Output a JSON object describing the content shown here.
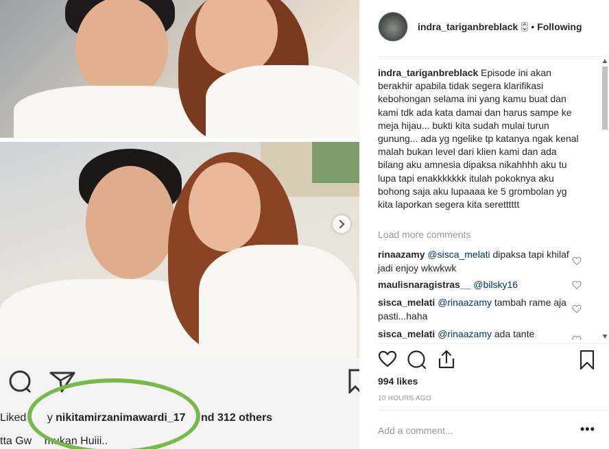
{
  "post": {
    "username": "indra_tariganbreblack",
    "following_label": "Following",
    "caption_user": "indra_tariganbreblack",
    "caption_text": "Episode ini akan berakhir apabila tidak segera klarifikasi kebohongan selama ini yang kamu buat dan kami tdk ada kata damai dan harus sampe ke meja hijau... bukti kita sudah mulai turun gunung... ada yg ngelike tp katanya ngak kenal malah bukan level dari klien kami dan ada bilang aku amnesia dipaksa nikahhhh aku tu lupa tapi enakkkkkkk itulah pokoknya aku bohong saja aku lupaaaa ke 5 grombolan yg kita laporkan segera kita seretttttt",
    "load_more": "Load more comments",
    "comments": [
      {
        "user": "rinaazamy",
        "mention": "@sisca_melati",
        "text": "dipaksa tapi khilaf jadi enjoy wkwkwk"
      },
      {
        "user": "maulisnaragistras__",
        "mention": "@bilsky16",
        "text": ""
      },
      {
        "user": "sisca_melati",
        "mention": "@rinaazamy",
        "text": "tambah rame aja pasti...haha"
      },
      {
        "user": "sisca_melati",
        "mention": "@rinaazamy",
        "text": "ada tante"
      }
    ],
    "likes": "994 likes",
    "time": "10 HOURS AGO",
    "add_comment_placeholder": "Add a comment...",
    "more_options": "•••"
  },
  "photo_embedded": {
    "liked_prefix": "Liked",
    "liked_by_fragment": "y",
    "liked_user": "nikitamirzanimawardi_17",
    "liked_suffix": "nd 312 others",
    "caption_fragment": "tta Gw",
    "caption_fragment_2": "mukan Huiii.."
  },
  "icons": {
    "heart": "heart-icon",
    "comment": "comment-icon",
    "share": "share-icon",
    "bookmark": "bookmark-icon",
    "next": "chevron-right-icon"
  },
  "colors": {
    "accent_link": "#003569",
    "muted": "#999999",
    "circle_annotation": "#79b84b"
  }
}
